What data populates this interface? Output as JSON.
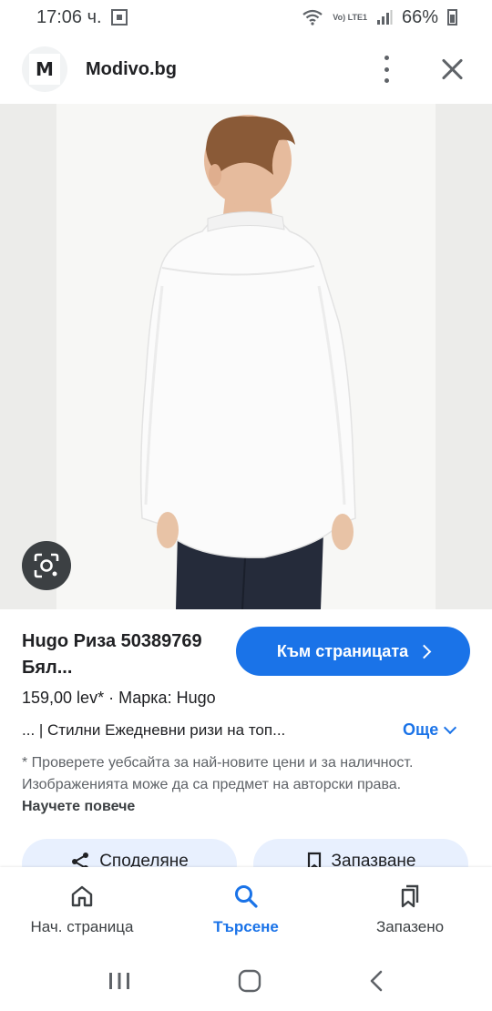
{
  "status_bar": {
    "time": "17:06 ч.",
    "network": "Vo) LTE1",
    "battery": "66%"
  },
  "header": {
    "site_name": "Modivo.bg",
    "logo_letter": "M"
  },
  "product": {
    "title": "Hugo Риза 50389769 Бял...",
    "price_line": "159,00 lev* · Марка: Hugo",
    "description": "... | Стилни Ежедневни ризи на топ...",
    "more_label": "Още",
    "visit_label": "Към страницата",
    "disclaimer": "* Проверете уебсайта за най-новите цени и за наличност. Изображенията може да са предмет на авторски права.",
    "learn_more": "Научете повече"
  },
  "actions": {
    "share_label": "Споделяне",
    "save_label": "Запазване"
  },
  "bottom_nav": {
    "items": [
      {
        "label": "Нач. страница",
        "icon": "home-icon"
      },
      {
        "label": "Търсене",
        "icon": "search-icon",
        "active": true
      },
      {
        "label": "Запазено",
        "icon": "saved-icon"
      }
    ]
  },
  "colors": {
    "accent": "#1a73e8",
    "chip_bg": "#e8f0fe"
  }
}
